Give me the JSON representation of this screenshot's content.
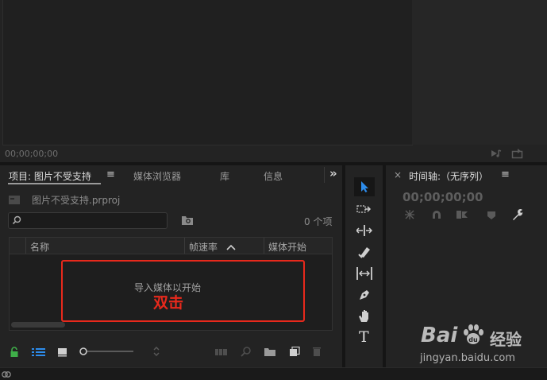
{
  "program_monitor": {
    "timecode": "00;00;00;00"
  },
  "project_panel": {
    "tabs": [
      {
        "label": "项目: 图片不受支持",
        "active": true
      },
      {
        "label": "媒体浏览器"
      },
      {
        "label": "库"
      },
      {
        "label": "信息"
      }
    ],
    "tab_menu_glyph": "≡",
    "overflow_glyph": "»",
    "project_file": "图片不受支持.prproj",
    "search": {
      "value": "",
      "placeholder": ""
    },
    "item_count": "0 个项",
    "columns": [
      "名称",
      "帧速率",
      "媒体开始"
    ],
    "sort_glyph": "︿",
    "empty_message": "导入媒体以开始",
    "annotation": "双击",
    "annotation_color": "#e8291c"
  },
  "tools": [
    {
      "name": "selection-tool",
      "icon": "arrow",
      "active": true
    },
    {
      "name": "track-select-tool",
      "icon": "track-select"
    },
    {
      "name": "ripple-edit-tool",
      "icon": "ripple"
    },
    {
      "name": "razor-tool",
      "icon": "razor"
    },
    {
      "name": "slip-tool",
      "icon": "slip"
    },
    {
      "name": "pen-tool",
      "icon": "pen"
    },
    {
      "name": "hand-tool",
      "icon": "hand"
    },
    {
      "name": "type-tool",
      "icon": "type",
      "glyph": "T"
    }
  ],
  "timeline_panel": {
    "close_glyph": "×",
    "title": "时间轴:（无序列）",
    "menu_glyph": "≡",
    "timecode": "00;00;00;00"
  },
  "watermark": {
    "brand_left": "Bai",
    "brand_right": "经验",
    "url": "jingyan.baidu.com"
  },
  "colors": {
    "accent": "#2d8ceb",
    "annotation": "#e8291c",
    "lock_green": "#3fae49"
  }
}
